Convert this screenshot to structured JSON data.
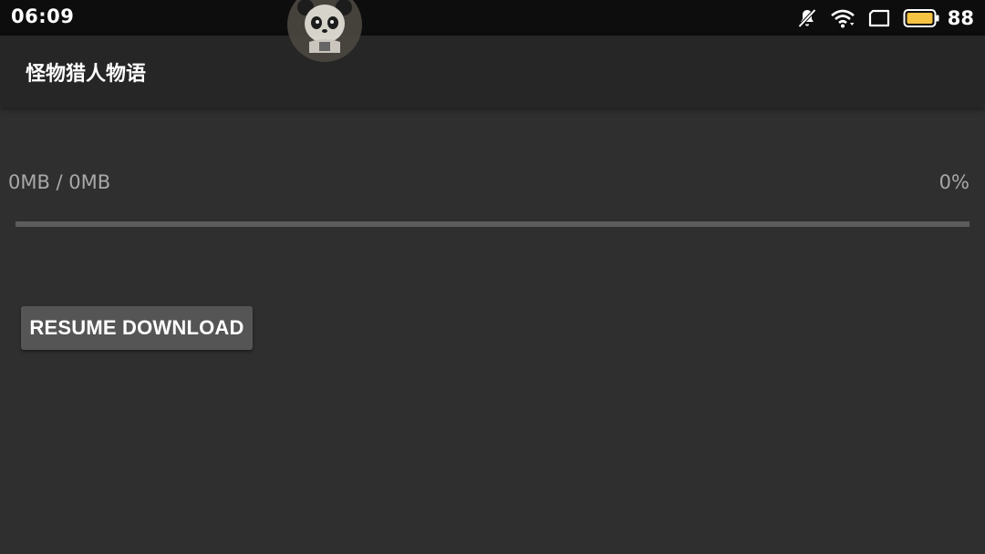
{
  "status_bar": {
    "time": "06:09",
    "battery_level": "88",
    "icons": [
      "bell-off-icon",
      "wifi-icon",
      "screen-rotation-icon",
      "battery-icon"
    ],
    "battery_color": "#f5c242"
  },
  "floating_icon": "panda-icon",
  "toolbar": {
    "title": "怪物猎人物语"
  },
  "download": {
    "size_text": "0MB / 0MB",
    "percent_text": "0%",
    "progress": 0,
    "resume_label": "RESUME DOWNLOAD"
  },
  "colors": {
    "background": "#2f2f2f",
    "toolbar": "#262626",
    "status_bar": "#0d0d0d",
    "button": "#555555",
    "progress_track": "#5c5c5c"
  }
}
